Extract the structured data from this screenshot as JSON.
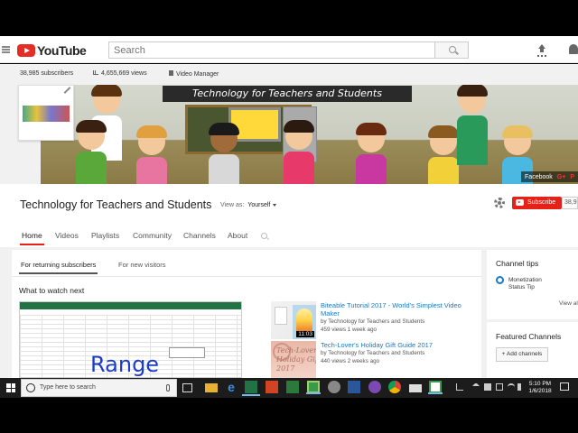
{
  "youtube": {
    "logo_text": "YouTube",
    "search_placeholder": "Search"
  },
  "stats": {
    "subscribers": "38,985 subscribers",
    "views": "4,655,669 views",
    "video_manager": "Video Manager"
  },
  "banner": {
    "title": "Technology for Teachers and Students",
    "social": [
      "Facebook",
      "G+",
      "P"
    ]
  },
  "channel": {
    "title": "Technology for Teachers and Students",
    "view_as_label": "View as:",
    "view_as_value": "Yourself",
    "subscribe_label": "Subscribe",
    "subscriber_count": "38,985"
  },
  "tabs": [
    "Home",
    "Videos",
    "Playlists",
    "Community",
    "Channels",
    "About"
  ],
  "subtabs": [
    "For returning subscribers",
    "For new visitors"
  ],
  "section_title": "What to watch next",
  "main_video": {
    "overlay_text": "Range"
  },
  "videos": [
    {
      "title": "Biteable Tutorial 2017 - World's Simplest Video Maker",
      "channel": "by Technology for Teachers and Students",
      "meta": "459 views   1 week ago",
      "duration": "11:03"
    },
    {
      "title": "Tech-Lover's Holiday Gift Guide 2017",
      "channel": "by Technology for Teachers and Students",
      "meta": "440 views   2 weeks ago",
      "thumb_text": "Tech-Lover's\nHoliday Gift Guide\n2017"
    }
  ],
  "channel_tips": {
    "title": "Channel tips",
    "item": "Monetization\nStatus Tip",
    "view_all": "View al"
  },
  "featured_channels": {
    "title": "Featured Channels",
    "add_label": "+ Add channels"
  },
  "taskbar": {
    "search_placeholder": "Type here to search",
    "time": "5:10 PM",
    "date": "1/6/2018"
  }
}
